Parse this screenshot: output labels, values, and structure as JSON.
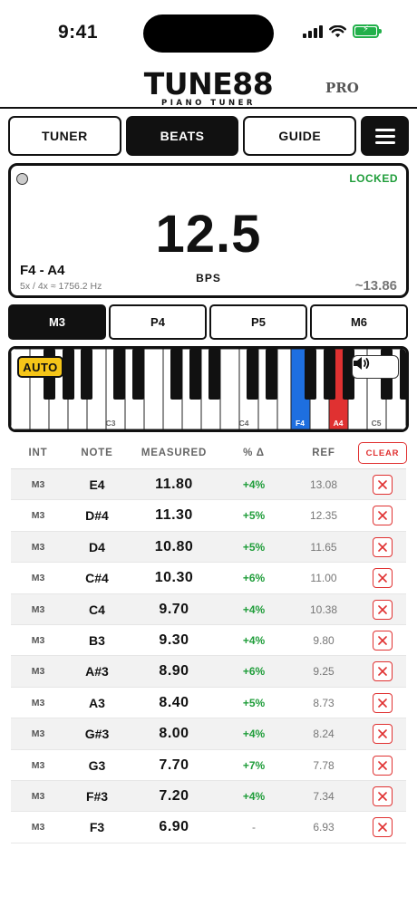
{
  "status": {
    "time": "9:41"
  },
  "app": {
    "title": "TUNE88",
    "subtitle": "PIANO TUNER",
    "badge": "PRO"
  },
  "nav": {
    "tabs": [
      {
        "label": "TUNER",
        "active": false
      },
      {
        "label": "BEATS",
        "active": true
      },
      {
        "label": "GUIDE",
        "active": false
      }
    ],
    "menu_icon": "hamburger-menu-icon"
  },
  "readout": {
    "status": "LOCKED",
    "value": "12.5",
    "unit": "BPS",
    "interval": "F4 - A4",
    "detail": "5x / 4x ≈ 1756.2 Hz",
    "reference": "~13.86"
  },
  "intervals": [
    {
      "label": "M3",
      "active": true
    },
    {
      "label": "P4",
      "active": false
    },
    {
      "label": "P5",
      "active": false
    },
    {
      "label": "M6",
      "active": false
    }
  ],
  "keyboard": {
    "auto_label": "AUTO",
    "speaker_icon": "speaker-icon",
    "labels": {
      "c3": "C3",
      "c4": "C4",
      "f4": "F4",
      "a4": "A4",
      "c5": "C5"
    },
    "colors": {
      "lower_note": "#1e6fe0",
      "upper_note": "#e03131",
      "auto": "#f5c518"
    }
  },
  "table": {
    "headers": {
      "int": "INT",
      "note": "NOTE",
      "measured": "MEASURED",
      "pct": "% Δ",
      "ref": "REF"
    },
    "clear_label": "CLEAR",
    "rows": [
      {
        "int": "M3",
        "note": "E4",
        "measured": "11.80",
        "pct": "+4%",
        "ref": "13.08"
      },
      {
        "int": "M3",
        "note": "D#4",
        "measured": "11.30",
        "pct": "+5%",
        "ref": "12.35"
      },
      {
        "int": "M3",
        "note": "D4",
        "measured": "10.80",
        "pct": "+5%",
        "ref": "11.65"
      },
      {
        "int": "M3",
        "note": "C#4",
        "measured": "10.30",
        "pct": "+6%",
        "ref": "11.00"
      },
      {
        "int": "M3",
        "note": "C4",
        "measured": "9.70",
        "pct": "+4%",
        "ref": "10.38"
      },
      {
        "int": "M3",
        "note": "B3",
        "measured": "9.30",
        "pct": "+4%",
        "ref": "9.80"
      },
      {
        "int": "M3",
        "note": "A#3",
        "measured": "8.90",
        "pct": "+6%",
        "ref": "9.25"
      },
      {
        "int": "M3",
        "note": "A3",
        "measured": "8.40",
        "pct": "+5%",
        "ref": "8.73"
      },
      {
        "int": "M3",
        "note": "G#3",
        "measured": "8.00",
        "pct": "+4%",
        "ref": "8.24"
      },
      {
        "int": "M3",
        "note": "G3",
        "measured": "7.70",
        "pct": "+7%",
        "ref": "7.78"
      },
      {
        "int": "M3",
        "note": "F#3",
        "measured": "7.20",
        "pct": "+4%",
        "ref": "7.34"
      },
      {
        "int": "M3",
        "note": "F3",
        "measured": "6.90",
        "pct": "-",
        "ref": "6.93"
      }
    ],
    "colors": {
      "positive": "#1f9d3a",
      "delete": "#e03131"
    }
  }
}
